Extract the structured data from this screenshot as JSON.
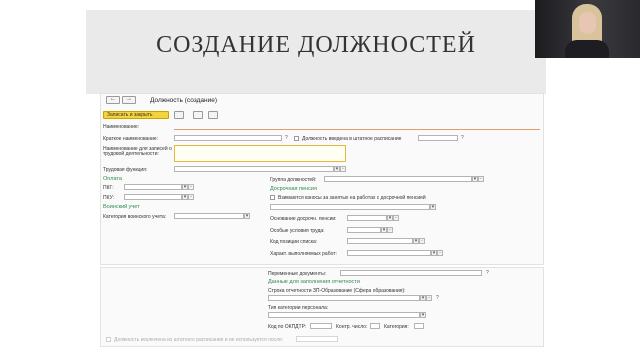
{
  "slide": {
    "title": "СОЗДАНИЕ ДОЛЖНОСТЕЙ"
  },
  "window": {
    "title": "Должность (создание)"
  },
  "nav": {
    "back": "←",
    "forward": "→"
  },
  "toolbar": {
    "save_close_label": "Записать и закрыть"
  },
  "form": {
    "name_label": "Наименование:",
    "short_name_label": "Краткое наименование:",
    "staff_checkbox_label": "Должность введена в штатное расписание",
    "docs_name_label": "Наименование для записей о трудовой деятельности:",
    "labor_function_label": "Трудовая функция:",
    "payment_header": "Оплата",
    "pkg_label": "ПКГ:",
    "pku_label": "ПКУ:",
    "military_header": "Воинский учет",
    "military_category_label": "Категория воинского учета:",
    "position_group_label": "Группа должностей:",
    "early_pension_header": "Досрочная пенсия",
    "early_pension_checkbox_label": "Взимаются взносы за занятых на работах с досрочной пенсией",
    "early_basis_label": "Основание досрочн. пенсии:",
    "special_conditions_label": "Особые условия труда:",
    "position_code_label": "Код позиции списка:",
    "work_characteristic_label": "Характ. выполняемых работ:",
    "transfer_docs_label": "Переменные документы:",
    "reporting_header": "Данные для заполнения отчетности",
    "reporting_row_label": "Строка отчетности ЗП-Образование (Сфера образования):",
    "personnel_category_label": "Тип категории персонала:",
    "okpdtr_label": "Код по ОКПДТР:",
    "control_number_label": "Контр. число:",
    "category_label": "Категория:",
    "excluded_checkbox_label": "Должность исключена из штатного расписания и не используется после:",
    "help_mark": "?"
  },
  "icons": {
    "save": "floppy-icon",
    "list": "list-icon",
    "print": "print-icon",
    "select": "dropdown-icon",
    "open": "link-icon"
  },
  "colors": {
    "primary_button": "#f5d33a",
    "required_border": "#e8a04a",
    "section_green": "#2d8a4e",
    "slide_band": "#eaeaea"
  }
}
